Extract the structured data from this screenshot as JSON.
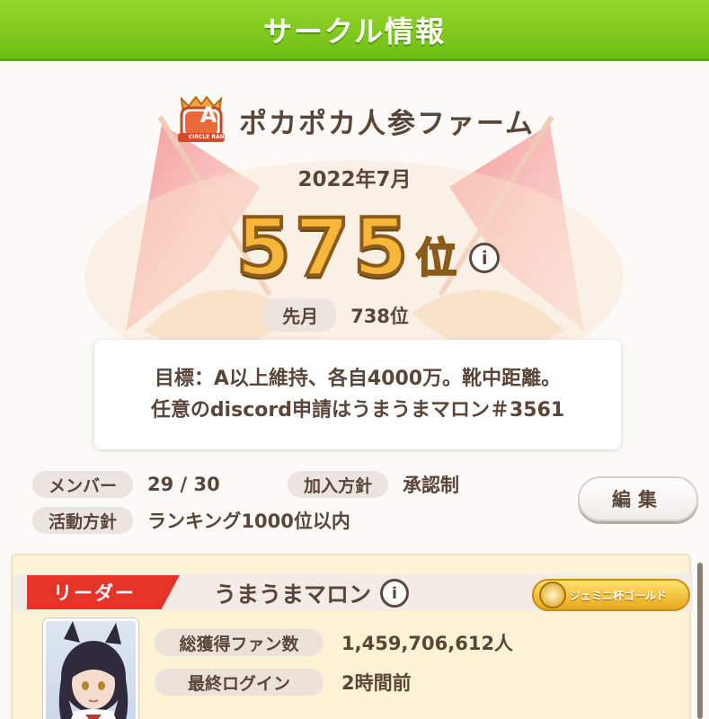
{
  "header": {
    "title": "サークル情報"
  },
  "circle": {
    "rank_badge": "A",
    "rank_badge_caption": "CIRCLE RANK",
    "name": "ポカポカ人参ファーム",
    "period": "2022年7月",
    "rank_number": "575",
    "rank_suffix": "位",
    "info_icon_glyph": "i",
    "prev_label": "先月",
    "prev_value": "738位",
    "goal_line1": "目標：A以上維持、各自4000万。靴中距離。",
    "goal_line2": "任意のdiscord申請はうまうまマロン＃3561"
  },
  "stats": {
    "members_label": "メンバー",
    "members_value": "29 / 30",
    "join_label": "加入方針",
    "join_value": "承認制",
    "activity_label": "活動方針",
    "activity_value": "ランキング1000位以内",
    "edit_label": "編集"
  },
  "leader": {
    "tag": "リーダー",
    "name": "うまうまマロン",
    "title_badge": "ジェミニ杯ゴールド",
    "fans_label": "総獲得ファン数",
    "fans_value": "1,459,706,612人",
    "login_label": "最終ログイン",
    "login_value": "2時間前"
  },
  "colors": {
    "header_green": "#7cc61e",
    "leader_red": "#e6332a",
    "gold": "#f6b63a"
  }
}
